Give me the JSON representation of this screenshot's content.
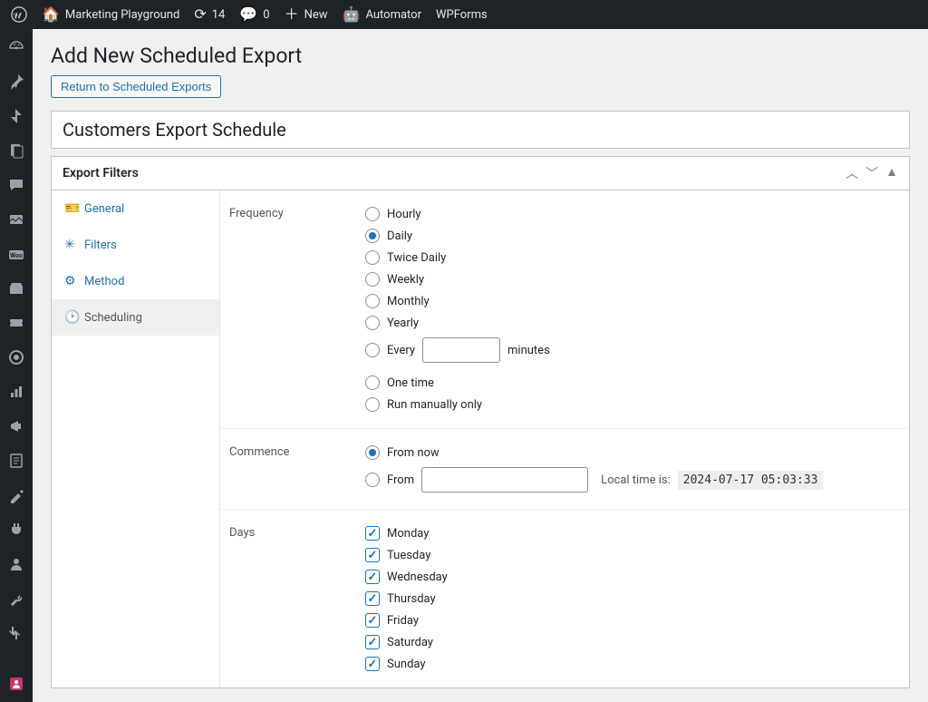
{
  "adminbar": {
    "site_name": "Marketing Playground",
    "updates": "14",
    "comments": "0",
    "new": "New",
    "automator": "Automator",
    "wpforms": "WPForms"
  },
  "page": {
    "title": "Add New Scheduled Export",
    "return_button": "Return to Scheduled Exports",
    "schedule_title": "Customers Export Schedule"
  },
  "panel": {
    "header": "Export Filters",
    "tabs": {
      "general": "General",
      "filters": "Filters",
      "method": "Method",
      "scheduling": "Scheduling"
    }
  },
  "frequency": {
    "label": "Frequency",
    "hourly": "Hourly",
    "daily": "Daily",
    "twice_daily": "Twice Daily",
    "weekly": "Weekly",
    "monthly": "Monthly",
    "yearly": "Yearly",
    "every": "Every",
    "minutes": "minutes",
    "one_time": "One time",
    "run_manually": "Run manually only"
  },
  "commence": {
    "label": "Commence",
    "from_now": "From now",
    "from": "From",
    "local_time_label": "Local time is:",
    "local_time_value": "2024-07-17 05:03:33"
  },
  "days": {
    "label": "Days",
    "monday": "Monday",
    "tuesday": "Tuesday",
    "wednesday": "Wednesday",
    "thursday": "Thursday",
    "friday": "Friday",
    "saturday": "Saturday",
    "sunday": "Sunday"
  }
}
